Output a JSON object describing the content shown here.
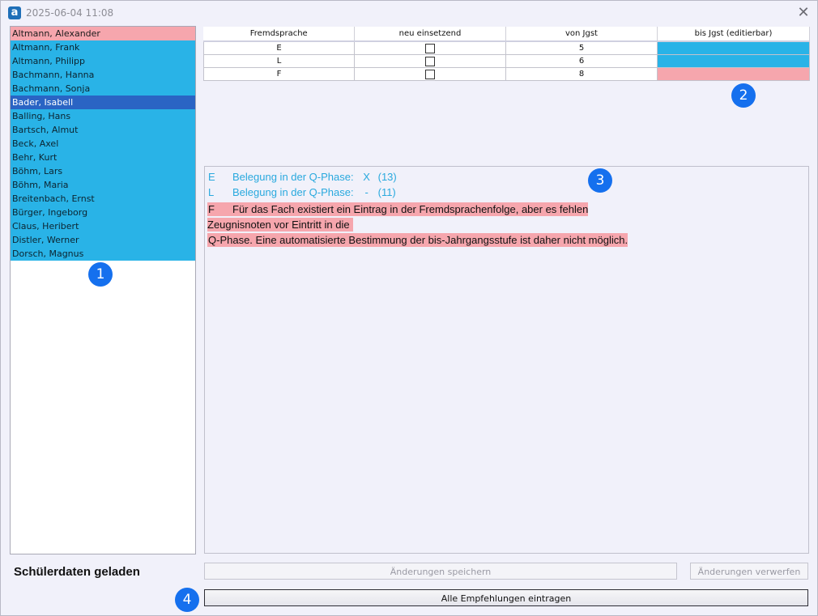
{
  "window": {
    "title": "2025-06-04 11:08",
    "app_icon_glyph": "a",
    "close_glyph": "✕"
  },
  "students": [
    {
      "name": "Altmann, Alexander",
      "state": "warn"
    },
    {
      "name": "Altmann, Frank",
      "state": "normal"
    },
    {
      "name": "Altmann, Philipp",
      "state": "normal"
    },
    {
      "name": "Bachmann, Hanna",
      "state": "normal"
    },
    {
      "name": "Bachmann, Sonja",
      "state": "normal"
    },
    {
      "name": "Bader, Isabell",
      "state": "selected"
    },
    {
      "name": "Balling, Hans",
      "state": "normal"
    },
    {
      "name": "Bartsch, Almut",
      "state": "normal"
    },
    {
      "name": "Beck, Axel",
      "state": "normal"
    },
    {
      "name": "Behr, Kurt",
      "state": "normal"
    },
    {
      "name": "Böhm, Lars",
      "state": "normal"
    },
    {
      "name": "Böhm, Maria",
      "state": "normal"
    },
    {
      "name": "Breitenbach, Ernst",
      "state": "normal"
    },
    {
      "name": "Bürger, Ingeborg",
      "state": "normal"
    },
    {
      "name": "Claus, Heribert",
      "state": "normal"
    },
    {
      "name": "Distler, Werner",
      "state": "normal"
    },
    {
      "name": "Dorsch, Magnus",
      "state": "normal"
    }
  ],
  "grid": {
    "headers": [
      "Fremdsprache",
      "neu einsetzend",
      "von Jgst",
      "bis Jgst (editierbar)"
    ],
    "rows": [
      {
        "sprache": "E",
        "neu": false,
        "von": "5",
        "bis": "",
        "bis_state": "blue"
      },
      {
        "sprache": "L",
        "neu": false,
        "von": "6",
        "bis": "",
        "bis_state": "blue"
      },
      {
        "sprache": "F",
        "neu": false,
        "von": "8",
        "bis": "",
        "bis_state": "pink"
      }
    ]
  },
  "messages": {
    "info": [
      {
        "code": "E",
        "text": "Belegung in der Q-Phase:",
        "flag": "X",
        "value": "(13)"
      },
      {
        "code": "L",
        "text": "Belegung in der Q-Phase:",
        "flag": "-",
        "value": "(11)"
      }
    ],
    "warning": {
      "code": "F",
      "line1": "Für das Fach existiert ein Eintrag in der Fremdsprachenfolge, aber es fehlen Zeugnisnoten vor Eintritt in die",
      "line2": "Q-Phase. Eine automatisierte Bestimmung der bis-Jahrgangsstufe ist daher nicht möglich."
    }
  },
  "status": "Schülerdaten geladen",
  "buttons": {
    "save": "Änderungen speichern",
    "discard": "Änderungen verwerfen",
    "apply_all": "Alle Empfehlungen eintragen"
  },
  "badges": [
    "1",
    "2",
    "3",
    "4"
  ],
  "colors": {
    "list_blue": "#29b3e7",
    "warn_pink": "#f6a6ad",
    "selected": "#2a64c4",
    "badge": "#1570ee",
    "info_text": "#29a9de"
  }
}
